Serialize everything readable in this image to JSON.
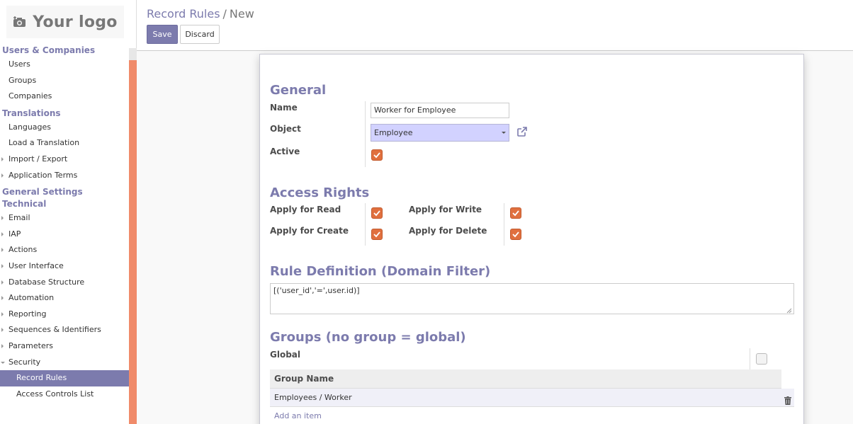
{
  "brand": {
    "logo_text": "Your logo"
  },
  "sidebar": {
    "sections": [
      {
        "title": "Users & Companies",
        "items": [
          "Users",
          "Groups",
          "Companies"
        ]
      },
      {
        "title": "Translations",
        "items": [
          "Languages",
          "Load a Translation",
          "Import / Export",
          "Application Terms"
        ]
      },
      {
        "title": "General Settings"
      },
      {
        "title": "Technical",
        "items": [
          "Email",
          "IAP",
          "Actions",
          "User Interface",
          "Database Structure",
          "Automation",
          "Reporting",
          "Sequences & Identifiers",
          "Parameters",
          "Security"
        ]
      }
    ],
    "security_children": [
      "Record Rules",
      "Access Controls List"
    ],
    "active_item": "Record Rules"
  },
  "breadcrumb": {
    "parent": "Record Rules",
    "separator": "/",
    "current": "New"
  },
  "buttons": {
    "save": "Save",
    "discard": "Discard"
  },
  "form": {
    "general": {
      "title": "General",
      "name_label": "Name",
      "name_value": "Worker for Employee",
      "object_label": "Object",
      "object_value": "Employee",
      "active_label": "Active",
      "active": true
    },
    "access_rights": {
      "title": "Access Rights",
      "read_label": "Apply for Read",
      "write_label": "Apply for Write",
      "create_label": "Apply for Create",
      "delete_label": "Apply for Delete",
      "read": true,
      "write": true,
      "create": true,
      "delete": true
    },
    "rule_definition": {
      "title": "Rule Definition (Domain Filter)",
      "domain": "[('user_id','=',user.id)]"
    },
    "groups": {
      "title": "Groups (no group = global)",
      "global_label": "Global",
      "global": false,
      "column_header": "Group Name",
      "rows": [
        "Employees / Worker"
      ],
      "add_item": "Add an item"
    }
  },
  "colors": {
    "accent": "#7c7bad",
    "checkbox": "#e0703f",
    "scrollbar": "#f08b6a"
  }
}
